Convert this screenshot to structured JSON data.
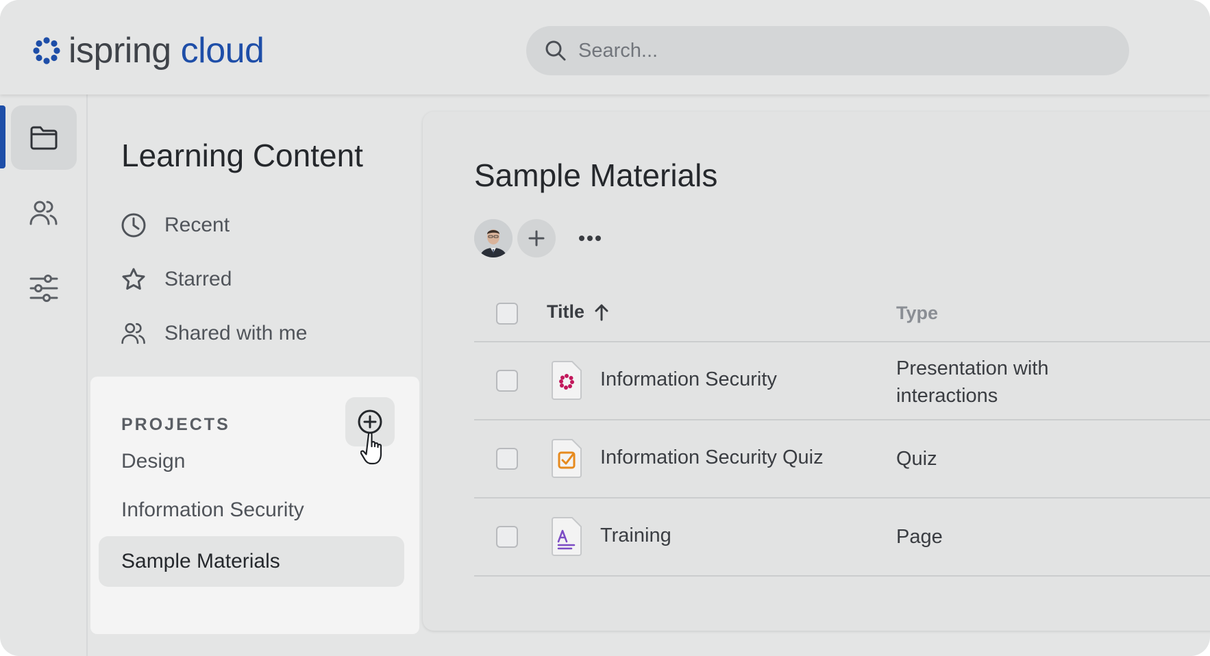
{
  "header": {
    "logo": {
      "brand_part1": "ispring",
      "brand_part2": "cloud",
      "brand_color": "#1e4ea8"
    },
    "search": {
      "placeholder": "Search...",
      "value": "",
      "icon": "search-icon"
    }
  },
  "rail": {
    "items": [
      {
        "icon": "folder-icon",
        "active": true
      },
      {
        "icon": "users-icon",
        "active": false
      },
      {
        "icon": "sliders-icon",
        "active": false
      }
    ],
    "accent_color": "#1e4ea8"
  },
  "nav": {
    "title": "Learning Content",
    "items": [
      {
        "label": "Recent",
        "icon": "clock-icon"
      },
      {
        "label": "Starred",
        "icon": "star-icon"
      },
      {
        "label": "Shared with me",
        "icon": "users-icon"
      }
    ],
    "projects": {
      "label": "PROJECTS",
      "add_icon": "plus-circle-icon",
      "items": [
        {
          "label": "Design",
          "selected": false
        },
        {
          "label": "Information Security",
          "selected": false
        },
        {
          "label": "Sample Materials",
          "selected": true
        }
      ]
    }
  },
  "main": {
    "title": "Sample Materials",
    "members": {
      "add_icon": "plus-icon",
      "more_icon": "more-horizontal-icon"
    },
    "table": {
      "columns": {
        "title": "Title",
        "type": "Type",
        "sort_icon": "arrow-up-icon"
      },
      "rows": [
        {
          "title": "Information Security",
          "type": "Presentation with interactions",
          "icon": "presentation-file-icon",
          "icon_color": "#c2185b"
        },
        {
          "title": "Information Security Quiz",
          "type": "Quiz",
          "icon": "quiz-file-icon",
          "icon_color": "#e68a1e"
        },
        {
          "title": "Training",
          "type": "Page",
          "icon": "page-file-icon",
          "icon_color": "#7b4bc4"
        }
      ]
    }
  }
}
